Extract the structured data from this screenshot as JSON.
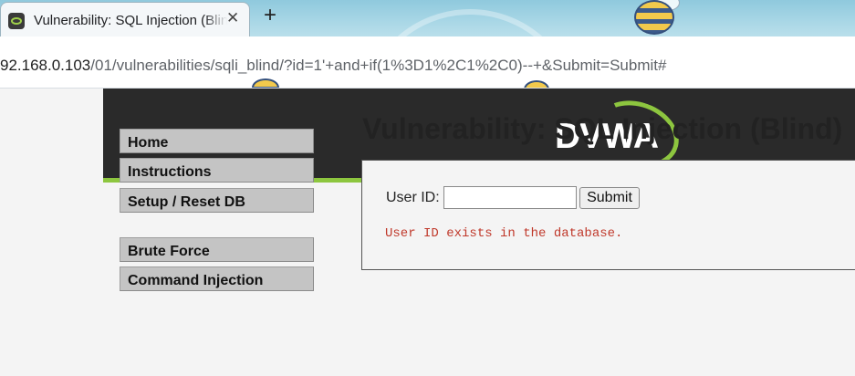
{
  "browser": {
    "tab": {
      "title": "Vulnerability: SQL Injection (Blind)",
      "close_glyph": "✕",
      "favicon": "dvwa-favicon-icon"
    },
    "new_tab_glyph": "+",
    "address": {
      "host": "92.168.0.103",
      "path": "/01/vulnerabilities/sqli_blind/?id=1'+and+if(1%3D1%2C1%2C0)--+&Submit=Submit#"
    }
  },
  "header": {
    "logo_text": "DVWA",
    "accent_color": "#8dc63f",
    "background_color": "#2a2a2a"
  },
  "menu": {
    "items": [
      "Home",
      "Instructions",
      "Setup / Reset DB",
      "Brute Force",
      "Command Injection"
    ]
  },
  "main": {
    "title": "Vulnerability: SQL Injection (Blind)",
    "form": {
      "user_id_label": "User ID:",
      "user_id_value": "",
      "submit_label": "Submit"
    },
    "result_message": "User ID exists in the database.",
    "result_color": "#c0392b"
  }
}
